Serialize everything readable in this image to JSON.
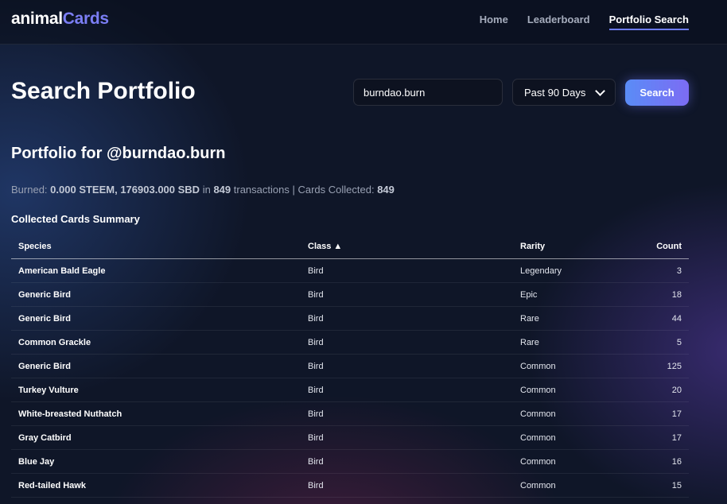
{
  "brand": {
    "part1": "animal",
    "part2": "Cards"
  },
  "nav": {
    "home": "Home",
    "leaderboard": "Leaderboard",
    "portfolio_search": "Portfolio Search"
  },
  "page_title": "Search Portfolio",
  "search": {
    "value": "burndao.burn",
    "range": "Past 90 Days",
    "button": "Search"
  },
  "portfolio": {
    "heading": "Portfolio for @burndao.burn",
    "burned_label": "Burned:",
    "burned_amount": "0.000 STEEM, 176903.000 SBD",
    "in_label": "in",
    "tx_count": "849",
    "tx_label": "transactions | Cards Collected:",
    "cards_collected": "849"
  },
  "summary_title": "Collected Cards Summary",
  "table": {
    "headers": {
      "species": "Species",
      "class": "Class ▲",
      "rarity": "Rarity",
      "count": "Count"
    },
    "rows": [
      {
        "species": "American Bald Eagle",
        "class": "Bird",
        "rarity": "Legendary",
        "count": "3"
      },
      {
        "species": "Generic Bird",
        "class": "Bird",
        "rarity": "Epic",
        "count": "18"
      },
      {
        "species": "Generic Bird",
        "class": "Bird",
        "rarity": "Rare",
        "count": "44"
      },
      {
        "species": "Common Grackle",
        "class": "Bird",
        "rarity": "Rare",
        "count": "5"
      },
      {
        "species": "Generic Bird",
        "class": "Bird",
        "rarity": "Common",
        "count": "125"
      },
      {
        "species": "Turkey Vulture",
        "class": "Bird",
        "rarity": "Common",
        "count": "20"
      },
      {
        "species": "White-breasted Nuthatch",
        "class": "Bird",
        "rarity": "Common",
        "count": "17"
      },
      {
        "species": "Gray Catbird",
        "class": "Bird",
        "rarity": "Common",
        "count": "17"
      },
      {
        "species": "Blue Jay",
        "class": "Bird",
        "rarity": "Common",
        "count": "16"
      },
      {
        "species": "Red-tailed Hawk",
        "class": "Bird",
        "rarity": "Common",
        "count": "15"
      }
    ]
  },
  "colors": {
    "accent": "#7b7ef5",
    "button_start": "#5a8cf7",
    "button_end": "#7c6cf3",
    "background": "#0f1628"
  }
}
